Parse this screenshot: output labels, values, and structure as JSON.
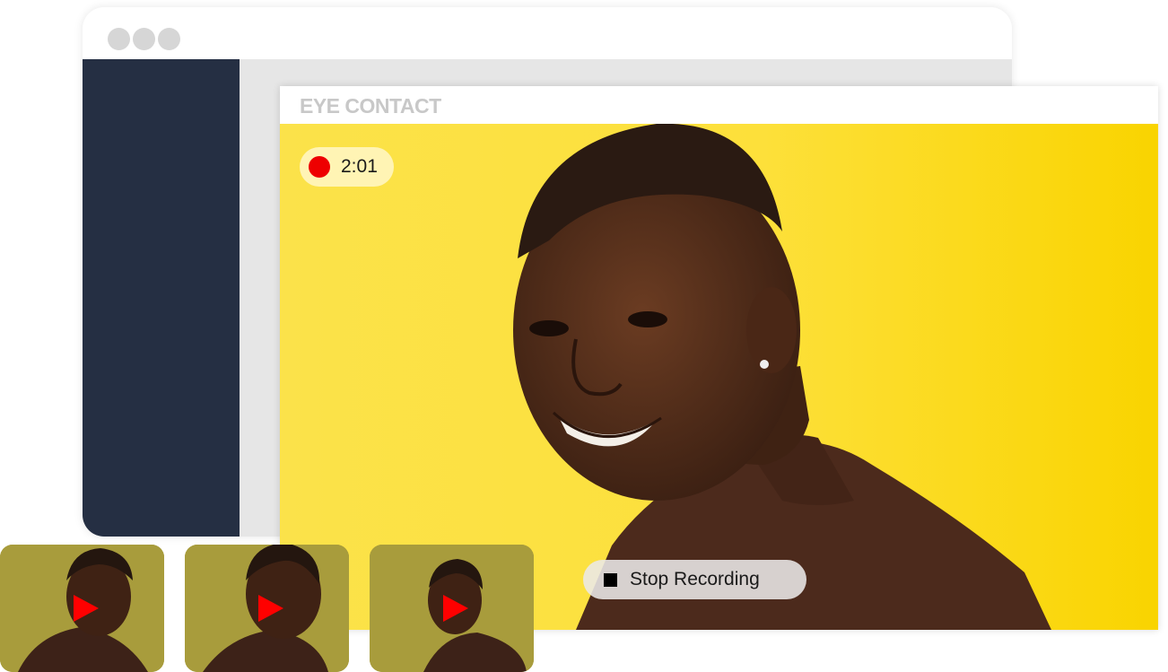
{
  "app": {
    "title": "EYE CONTACT"
  },
  "recording": {
    "elapsed": "2:01",
    "indicator_color": "#ee0000",
    "stop_label": "Stop Recording"
  },
  "colors": {
    "sidebar": "#252f43",
    "background_yellow": "#fde03a",
    "play_icon": "#ff0000"
  },
  "thumbnails": [
    {
      "icon": "play-icon"
    },
    {
      "icon": "play-icon"
    },
    {
      "icon": "play-icon"
    }
  ]
}
